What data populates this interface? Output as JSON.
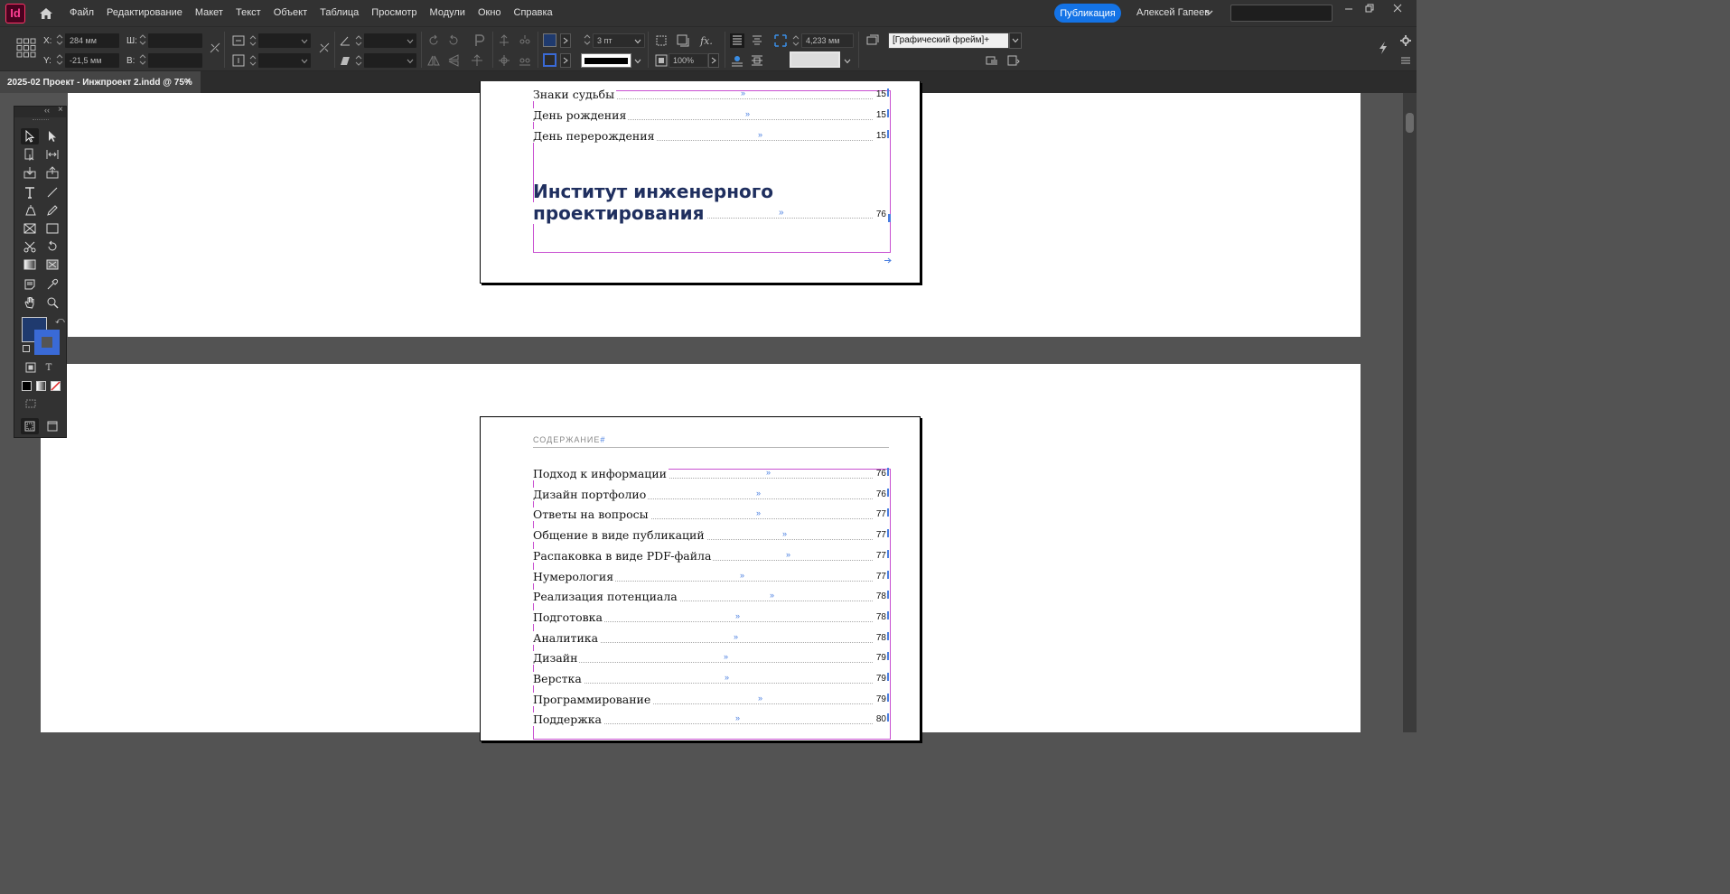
{
  "app": {
    "logo_text": "Id"
  },
  "menu": [
    "Файл",
    "Редактирование",
    "Макет",
    "Текст",
    "Объект",
    "Таблица",
    "Просмотр",
    "Модули",
    "Окно",
    "Справка"
  ],
  "header": {
    "publish_label": "Публикация",
    "user_name": "Алексей Гапеев"
  },
  "control": {
    "x_label": "X:",
    "x_value": "284 мм",
    "y_label": "Y:",
    "y_value": "-21,5 мм",
    "w_label": "Ш:",
    "h_label": "В:",
    "stroke_weight": "3 пт",
    "scale_value": "100%",
    "gutter_value": "4,233 мм",
    "frame_style": "[Графический фрейм]+"
  },
  "document": {
    "tab_title": "2025-02 Проект - Инжпроект 2.indd @ 75%",
    "close_symbol": "×"
  },
  "page1": {
    "entries": [
      {
        "title": "Знаки судьбы",
        "page": "15"
      },
      {
        "title": "День рождения",
        "page": "15"
      },
      {
        "title": "День перерождения",
        "page": "15"
      }
    ],
    "section_heading_line1": "Институт инженерного",
    "section_heading_line2": "проектирования",
    "section_page": "76"
  },
  "page2": {
    "running_head": "СОДЕРЖАНИЕ",
    "entries": [
      {
        "title": "Подход к информации",
        "page": "76"
      },
      {
        "title": "Дизайн портфолио",
        "page": "76"
      },
      {
        "title": "Ответы на вопросы",
        "page": "77"
      },
      {
        "title": "Общение в виде публикаций",
        "page": "77"
      },
      {
        "title": "Распаковка в виде PDF-файла",
        "page": "77"
      },
      {
        "title": "Нумерология",
        "page": "77"
      },
      {
        "title": "Реализация потенциала",
        "page": "78"
      },
      {
        "title": "Подготовка",
        "page": "78"
      },
      {
        "title": "Аналитика",
        "page": "78"
      },
      {
        "title": "Дизайн",
        "page": "79"
      },
      {
        "title": "Верстка",
        "page": "79"
      },
      {
        "title": "Программирование",
        "page": "79"
      },
      {
        "title": "Поддержка",
        "page": "80"
      }
    ]
  },
  "colors": {
    "accent": "#1473e6",
    "fill_swatch": "#1f3a6e",
    "frame_edge": "#c84fd1",
    "heading": "#1f2f5f"
  }
}
